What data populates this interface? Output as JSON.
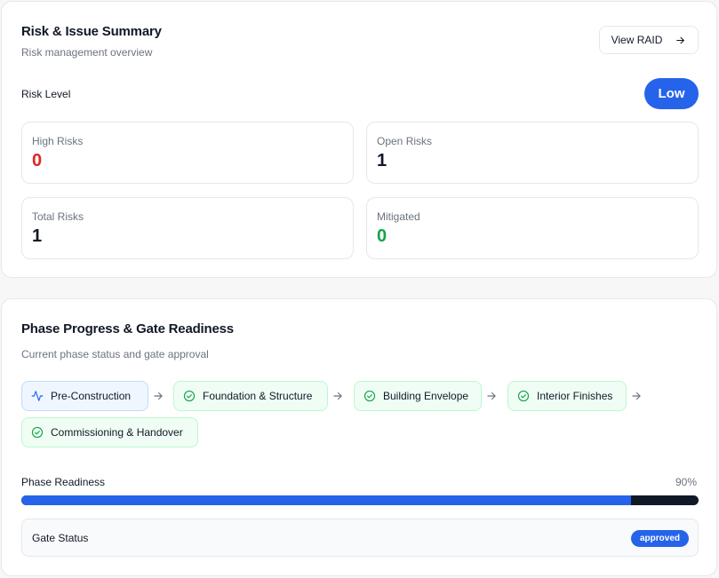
{
  "risk_summary": {
    "title": "Risk & Issue Summary",
    "subtitle": "Risk management overview",
    "view_button_label": "View RAID",
    "risk_level_label": "Risk Level",
    "risk_level_value": "Low",
    "stats": {
      "high_risks": {
        "label": "High Risks",
        "value": "0",
        "color": "#dc2626"
      },
      "open_risks": {
        "label": "Open Risks",
        "value": "1",
        "color": "#111827"
      },
      "total_risks": {
        "label": "Total Risks",
        "value": "1",
        "color": "#111827"
      },
      "mitigated": {
        "label": "Mitigated",
        "value": "0",
        "color": "#16a34a"
      }
    }
  },
  "phase_progress": {
    "title": "Phase Progress & Gate Readiness",
    "subtitle": "Current phase status and gate approval",
    "phases": [
      {
        "label": "Pre-Construction",
        "status": "current",
        "icon": "activity-icon"
      },
      {
        "label": "Foundation & Structure",
        "status": "complete",
        "icon": "check-circle-icon"
      },
      {
        "label": "Building Envelope",
        "status": "complete",
        "icon": "check-circle-icon"
      },
      {
        "label": "Interior Finishes",
        "status": "complete",
        "icon": "check-circle-icon"
      },
      {
        "label": "Commissioning & Handover",
        "status": "complete",
        "icon": "check-circle-icon"
      }
    ],
    "readiness_label": "Phase Readiness",
    "readiness_percent": 90,
    "readiness_text": "90%",
    "gate_status_label": "Gate Status",
    "gate_status_value": "approved"
  },
  "colors": {
    "accent": "#2563eb",
    "danger": "#dc2626",
    "success": "#16a34a",
    "track": "#111827"
  }
}
